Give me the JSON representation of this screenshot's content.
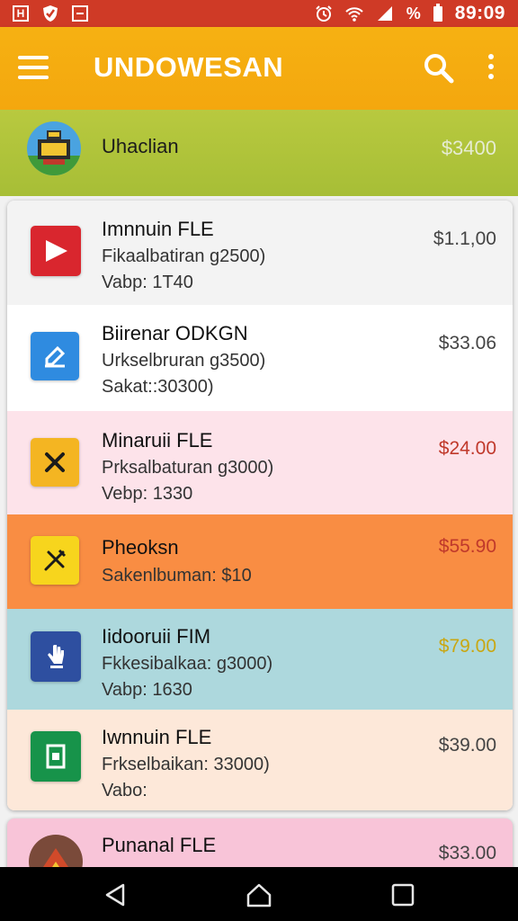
{
  "status_bar": {
    "left_icons": [
      "h-box-icon",
      "shield-icon",
      "minus-box-icon"
    ],
    "percent": "%",
    "time": "89:09"
  },
  "app_bar": {
    "title": "UNDOWESAN"
  },
  "header": {
    "name": "Uhaclian",
    "price": "$3400"
  },
  "items": [
    {
      "title": "Imnnuin FLE",
      "line1": "Fikaalbatiran g2500)",
      "line2": "Vabp: 1T40",
      "price": "$1.1,00",
      "icon": "play-icon",
      "icon_bg": "#d9262e",
      "row_bg": "#f3f3f3",
      "price_color": "#444444"
    },
    {
      "title": "Biirenar ODKGN",
      "line1": "Urkselbruran g3500)",
      "line2": "Sakat::30300)",
      "price": "$33.06",
      "icon": "edit-icon",
      "icon_bg": "#2f8be0",
      "row_bg": "#ffffff",
      "price_color": "#444444"
    },
    {
      "title": "Minaruii FLE",
      "line1": "Prksalbaturan g3000)",
      "line2": "Vebp: 1330",
      "price": "$24.00",
      "icon": "close-x-icon",
      "icon_bg": "#f4b522",
      "row_bg": "#fde3ea",
      "price_color": "#c0392b"
    },
    {
      "title": "Pheoksn",
      "line1": "Sakenlbuman: $10",
      "line2": "",
      "price": "$55.90",
      "icon": "tools-icon",
      "icon_bg": "#f7d51d",
      "row_bg": "#f98d43",
      "price_color": "#c0392b"
    },
    {
      "title": "Iidooruii FIM",
      "line1": "Fkkesibalkaa: g3000)",
      "line2": "Vabp: 1630",
      "price": "$79.00",
      "icon": "hand-icon",
      "icon_bg": "#2e4fa0",
      "row_bg": "#add8dd",
      "price_color": "#c9a712"
    },
    {
      "title": "Iwnnuin FLE",
      "line1": "Frkselbaikan: 33000)",
      "line2": "Vabo:",
      "price": "$39.00",
      "icon": "receipt-icon",
      "icon_bg": "#17934a",
      "row_bg": "#fde8d9",
      "price_color": "#444444"
    }
  ],
  "last_item": {
    "title": "Punanal FLE",
    "price": "$33.00"
  }
}
